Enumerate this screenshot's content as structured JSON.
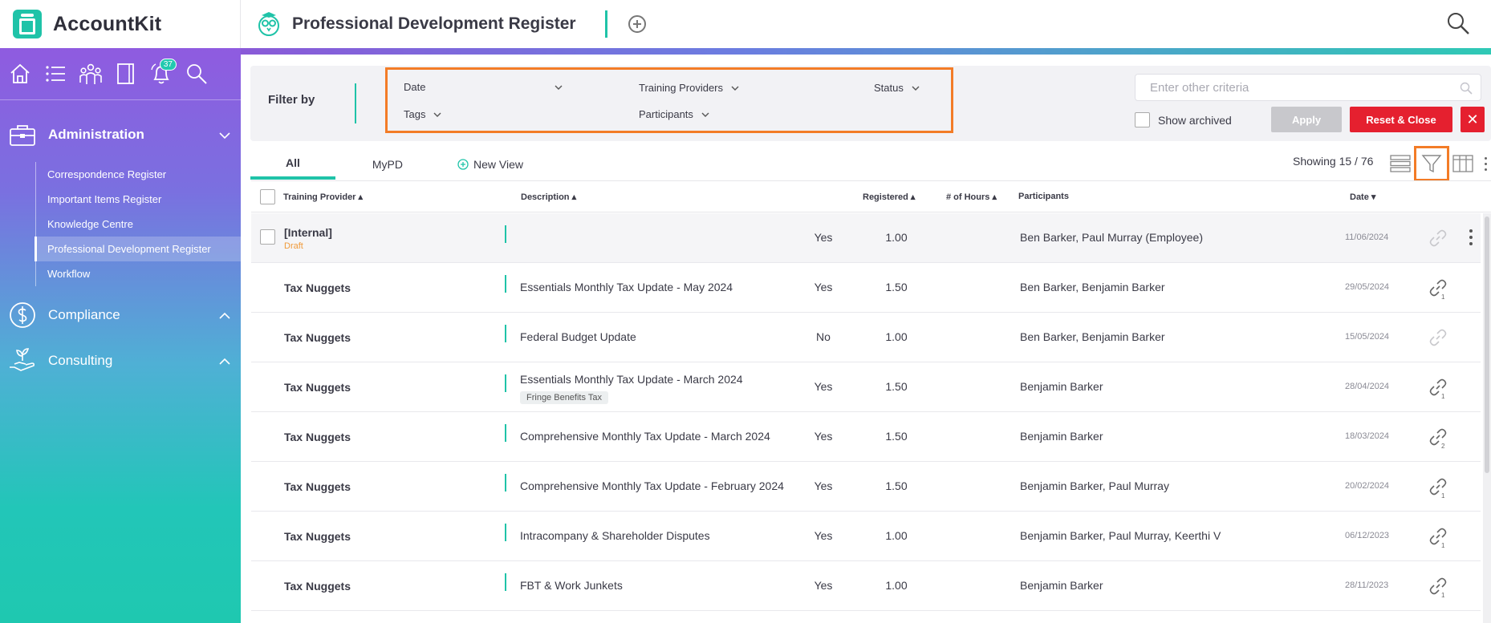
{
  "app": {
    "name": "AccountKit",
    "page_title": "Professional Development Register"
  },
  "sidebar": {
    "notification_count": "37",
    "sections": [
      {
        "label": "Administration",
        "items": [
          "Correspondence Register",
          "Important Items Register",
          "Knowledge Centre",
          "Professional Development Register",
          "Workflow"
        ]
      },
      {
        "label": "Compliance"
      },
      {
        "label": "Consulting"
      }
    ]
  },
  "filter": {
    "label": "Filter by",
    "fields": {
      "date": "Date",
      "training_providers": "Training Providers",
      "status": "Status",
      "tags": "Tags",
      "participants": "Participants"
    },
    "criteria_placeholder": "Enter other criteria",
    "show_archived": "Show archived",
    "apply": "Apply",
    "reset_close": "Reset & Close",
    "close": "✕"
  },
  "tabs": {
    "all": "All",
    "mypd": "MyPD",
    "new_view": "New View"
  },
  "showing": "Showing 15 / 76",
  "table": {
    "headers": {
      "provider": "Training Provider ▴",
      "description": "Description ▴",
      "registered": "Registered ▴",
      "hours": "# of Hours ▴",
      "participants": "Participants",
      "date": "Date ▾"
    },
    "rows": [
      {
        "provider": "[Internal]",
        "status": "Draft",
        "description": "",
        "tag": "",
        "registered": "Yes",
        "hours": "1.00",
        "participants": "Ben Barker, Paul Murray (Employee)",
        "date": "11/06/2024",
        "links": ""
      },
      {
        "provider": "Tax Nuggets",
        "description": "Essentials Monthly Tax Update - May 2024",
        "tag": "",
        "registered": "Yes",
        "hours": "1.50",
        "participants": "Ben Barker, Benjamin Barker",
        "date": "29/05/2024",
        "links": "1"
      },
      {
        "provider": "Tax Nuggets",
        "description": "Federal Budget Update",
        "tag": "",
        "registered": "No",
        "hours": "1.00",
        "participants": "Ben Barker, Benjamin Barker",
        "date": "15/05/2024",
        "links": ""
      },
      {
        "provider": "Tax Nuggets",
        "description": "Essentials Monthly Tax Update - March 2024",
        "tag": "Fringe Benefits Tax",
        "registered": "Yes",
        "hours": "1.50",
        "participants": "Benjamin Barker",
        "date": "28/04/2024",
        "links": "1"
      },
      {
        "provider": "Tax Nuggets",
        "description": "Comprehensive Monthly Tax Update - March 2024",
        "tag": "",
        "registered": "Yes",
        "hours": "1.50",
        "participants": "Benjamin Barker",
        "date": "18/03/2024",
        "links": "2"
      },
      {
        "provider": "Tax Nuggets",
        "description": "Comprehensive Monthly Tax Update - February 2024",
        "tag": "",
        "registered": "Yes",
        "hours": "1.50",
        "participants": "Benjamin Barker, Paul Murray",
        "date": "20/02/2024",
        "links": "1"
      },
      {
        "provider": "Tax Nuggets",
        "description": "Intracompany & Shareholder Disputes",
        "tag": "",
        "registered": "Yes",
        "hours": "1.00",
        "participants": "Benjamin Barker, Paul Murray, Keerthi V",
        "date": "06/12/2023",
        "links": "1"
      },
      {
        "provider": "Tax Nuggets",
        "description": "FBT & Work Junkets",
        "tag": "",
        "registered": "Yes",
        "hours": "1.00",
        "participants": "Benjamin Barker",
        "date": "28/11/2023",
        "links": "1"
      }
    ]
  },
  "colors": {
    "accent": "#1fc3a8",
    "highlight": "#f37c27",
    "danger": "#e5202f",
    "sidebar_top": "#8f5be0",
    "sidebar_bottom": "#1fc8b0"
  }
}
